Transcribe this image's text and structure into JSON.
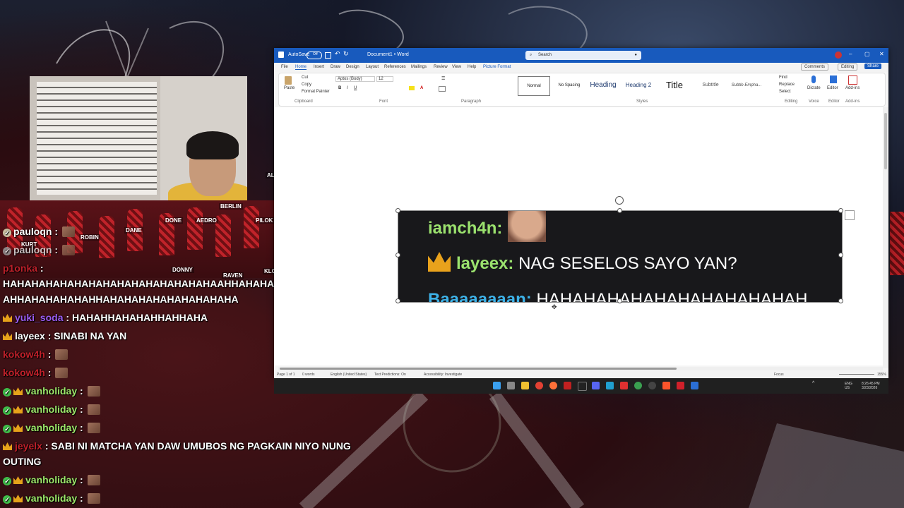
{
  "chat": {
    "messages": [
      {
        "user": "pauloqn",
        "text": "",
        "color": "#ffffff",
        "badges": [
          "check-dim"
        ],
        "emote": true
      },
      {
        "user": "pauloqn",
        "text": "",
        "color": "#dddddd",
        "badges": [
          "check-dim"
        ],
        "emote": true
      },
      {
        "user": "p1onka",
        "text": "",
        "color": "#c0202a"
      },
      {
        "user": "",
        "text": "HAHAHAHAHAHAHAHAHAHAHAHAHAHAHAAHHAHAHAHAH",
        "color": "#ffffff"
      },
      {
        "user": "",
        "text": "AHHAHAHAHAHAHHAHAHAHAHAHAHAHAHAHA",
        "color": "#ffffff"
      },
      {
        "user": "yuki_soda",
        "text": "HAHAHHAHAHAHHAHHAHA",
        "color": "#9b5cf0",
        "badges": [
          "crown"
        ]
      },
      {
        "user": "layeex",
        "text": "SINABI NA YAN",
        "color": "#ffffff",
        "badges": [
          "crown"
        ]
      },
      {
        "user": "kokow4h",
        "text": "",
        "color": "#c0202a",
        "emote": true
      },
      {
        "user": "kokow4h",
        "text": "",
        "color": "#c0202a",
        "emote": true
      },
      {
        "user": "vanholiday",
        "text": "",
        "color": "#9ee86a",
        "badges": [
          "check",
          "crown"
        ],
        "emote": true
      },
      {
        "user": "vanholiday",
        "text": "",
        "color": "#9ee86a",
        "badges": [
          "check",
          "crown"
        ],
        "emote": true
      },
      {
        "user": "vanholiday",
        "text": "",
        "color": "#9ee86a",
        "badges": [
          "check",
          "crown"
        ],
        "emote": true
      },
      {
        "user": "jeyelx",
        "text": "SABI NI MATCHA YAN DAW UMUBOS NG PAGKAIN NIYO NUNG",
        "color": "#c0202a",
        "badges": [
          "crown"
        ]
      },
      {
        "user": "",
        "text": "OUTING",
        "color": "#ffffff"
      },
      {
        "user": "vanholiday",
        "text": "",
        "color": "#9ee86a",
        "badges": [
          "check",
          "crown"
        ],
        "emote": true
      },
      {
        "user": "vanholiday",
        "text": "",
        "color": "#9ee86a",
        "badges": [
          "check",
          "crown"
        ],
        "emote": true
      }
    ]
  },
  "game_tags": [
    "BERLIN",
    "DONE",
    "AEDRO",
    "PILOK",
    "ROBIN",
    "DANE",
    "KURT",
    "DONNY",
    "RAVEN",
    "KLO",
    "AL"
  ],
  "word": {
    "autosave": "AutoSave",
    "toggle_state": "Off",
    "doc_title": "Document1 • Word",
    "search_placeholder": "Search",
    "menu": [
      "File",
      "Home",
      "Insert",
      "Draw",
      "Design",
      "Layout",
      "References",
      "Mailings",
      "Review",
      "View",
      "Help",
      "Picture Format"
    ],
    "comments": "Comments",
    "editing": "Editing",
    "share": "Share",
    "clipboard": {
      "paste": "Paste",
      "cut": "Cut",
      "copy": "Copy",
      "painter": "Format Painter",
      "group": "Clipboard"
    },
    "font": {
      "name": "Aptos (Body)",
      "size": "12",
      "group": "Font"
    },
    "paragraph_group": "Paragraph",
    "styles": [
      "Normal",
      "No Spacing",
      "Heading",
      "Heading 2",
      "Title",
      "Subtitle",
      "Subtle Empha..."
    ],
    "styles_group": "Styles",
    "editing_tools": {
      "find": "Find",
      "replace": "Replace",
      "select": "Select",
      "group": "Editing"
    },
    "voice": {
      "dictate": "Dictate",
      "group": "Voice"
    },
    "editor": {
      "label": "Editor",
      "group": "Editor"
    },
    "addins": {
      "label": "Add-ins",
      "group": "Add-ins"
    },
    "status": {
      "page": "Page 1 of 1",
      "words": "0 words",
      "language": "English (United States)",
      "text_predictions": "Text Predictions: On",
      "accessibility": "Accessibility: Investigate",
      "focus": "Focus",
      "zoom": "155%"
    }
  },
  "image": {
    "line1_user": "iamch4n:",
    "line2_user": "layeex:",
    "line2_text": "NAG SESELOS SAYO YAN?",
    "line3_user": "Baaaaaaaan:",
    "line3_text": "HAHAHAHAHAHAHAHAHAHAHAH",
    "user1_color": "#9be26e",
    "user2_color": "#9be26e",
    "user3_color": "#3db2e8"
  },
  "taskbar": {
    "lang": "ENG",
    "region": "US",
    "time": "8:26:45 PM",
    "date": "3/23/2026"
  }
}
